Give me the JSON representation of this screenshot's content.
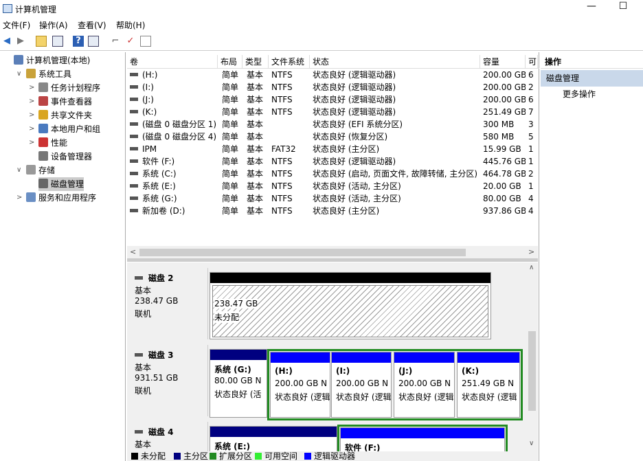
{
  "window": {
    "title": "计算机管理",
    "min": "—",
    "max": "☐"
  },
  "menu": [
    "文件(F)",
    "操作(A)",
    "查看(V)",
    "帮助(H)"
  ],
  "tree": [
    {
      "label": "计算机管理(本地)",
      "indent": 0,
      "exp": "",
      "icon": "#5b7fb8"
    },
    {
      "label": "系统工具",
      "indent": 1,
      "exp": "∨",
      "icon": "#c9a23a"
    },
    {
      "label": "任务计划程序",
      "indent": 2,
      "exp": ">",
      "icon": "#888"
    },
    {
      "label": "事件查看器",
      "indent": 2,
      "exp": ">",
      "icon": "#b44"
    },
    {
      "label": "共享文件夹",
      "indent": 2,
      "exp": ">",
      "icon": "#d9a520"
    },
    {
      "label": "本地用户和组",
      "indent": 2,
      "exp": ">",
      "icon": "#4a7abf"
    },
    {
      "label": "性能",
      "indent": 2,
      "exp": ">",
      "icon": "#c33"
    },
    {
      "label": "设备管理器",
      "indent": 2,
      "exp": "",
      "icon": "#777"
    },
    {
      "label": "存储",
      "indent": 1,
      "exp": "∨",
      "icon": "#999"
    },
    {
      "label": "磁盘管理",
      "indent": 2,
      "exp": "",
      "icon": "#666",
      "selected": true
    },
    {
      "label": "服务和应用程序",
      "indent": 1,
      "exp": ">",
      "icon": "#6a8fc4"
    }
  ],
  "columns": [
    "卷",
    "布局",
    "类型",
    "文件系统",
    "状态",
    "容量",
    "可"
  ],
  "volumes": [
    {
      "v": "(H:)",
      "l": "简单",
      "t": "基本",
      "f": "NTFS",
      "s": "状态良好 (逻辑驱动器)",
      "c": "200.00 GB",
      "x": "6"
    },
    {
      "v": "(I:)",
      "l": "简单",
      "t": "基本",
      "f": "NTFS",
      "s": "状态良好 (逻辑驱动器)",
      "c": "200.00 GB",
      "x": "2"
    },
    {
      "v": "(J:)",
      "l": "简单",
      "t": "基本",
      "f": "NTFS",
      "s": "状态良好 (逻辑驱动器)",
      "c": "200.00 GB",
      "x": "6"
    },
    {
      "v": "(K:)",
      "l": "简单",
      "t": "基本",
      "f": "NTFS",
      "s": "状态良好 (逻辑驱动器)",
      "c": "251.49 GB",
      "x": "7"
    },
    {
      "v": "(磁盘 0 磁盘分区 1)",
      "l": "简单",
      "t": "基本",
      "f": "",
      "s": "状态良好 (EFI 系统分区)",
      "c": "300 MB",
      "x": "3"
    },
    {
      "v": "(磁盘 0 磁盘分区 4)",
      "l": "简单",
      "t": "基本",
      "f": "",
      "s": "状态良好 (恢复分区)",
      "c": "580 MB",
      "x": "5"
    },
    {
      "v": "IPM",
      "l": "简单",
      "t": "基本",
      "f": "FAT32",
      "s": "状态良好 (主分区)",
      "c": "15.99 GB",
      "x": "1"
    },
    {
      "v": "软件 (F:)",
      "l": "简单",
      "t": "基本",
      "f": "NTFS",
      "s": "状态良好 (逻辑驱动器)",
      "c": "445.76 GB",
      "x": "1"
    },
    {
      "v": "系统 (C:)",
      "l": "简单",
      "t": "基本",
      "f": "NTFS",
      "s": "状态良好 (启动, 页面文件, 故障转储, 主分区)",
      "c": "464.78 GB",
      "x": "2"
    },
    {
      "v": "系统 (E:)",
      "l": "简单",
      "t": "基本",
      "f": "NTFS",
      "s": "状态良好 (活动, 主分区)",
      "c": "20.00 GB",
      "x": "1"
    },
    {
      "v": "系统 (G:)",
      "l": "简单",
      "t": "基本",
      "f": "NTFS",
      "s": "状态良好 (活动, 主分区)",
      "c": "80.00 GB",
      "x": "4"
    },
    {
      "v": "新加卷 (D:)",
      "l": "简单",
      "t": "基本",
      "f": "NTFS",
      "s": "状态良好 (主分区)",
      "c": "937.86 GB",
      "x": "4"
    }
  ],
  "disks": {
    "d2": {
      "name": "磁盘 2",
      "type": "基本",
      "size": "238.47 GB",
      "state": "联机",
      "p": {
        "size": "238.47 GB",
        "status": "未分配"
      }
    },
    "d3": {
      "name": "磁盘 3",
      "type": "基本",
      "size": "931.51 GB",
      "state": "联机",
      "g": {
        "name": "系统 (G:)",
        "size": "80.00 GB N",
        "status": "状态良好 (活"
      },
      "h": {
        "name": "(H:)",
        "size": "200.00 GB N",
        "status": "状态良好 (逻辑"
      },
      "i": {
        "name": "(I:)",
        "size": "200.00 GB N",
        "status": "状态良好 (逻辑"
      },
      "j": {
        "name": "(J:)",
        "size": "200.00 GB N",
        "status": "状态良好 (逻辑"
      },
      "k": {
        "name": "(K:)",
        "size": "251.49 GB N",
        "status": "状态良好 (逻辑"
      }
    },
    "d4": {
      "name": "磁盘 4",
      "type": "基本",
      "e": {
        "name": "系统 (E:)"
      },
      "f": {
        "name": "软件 (F:)"
      }
    }
  },
  "legend": [
    {
      "label": "未分配",
      "color": "#000000"
    },
    {
      "label": "主分区",
      "color": "#000080"
    },
    {
      "label": "扩展分区",
      "color": "#228b22"
    },
    {
      "label": "可用空间",
      "color": "#33ee33"
    },
    {
      "label": "逻辑驱动器",
      "color": "#0000ff"
    }
  ],
  "actions": {
    "header": "操作",
    "section": "磁盘管理",
    "more": "更多操作"
  },
  "colors": {
    "primary": "#000080",
    "logical": "#0000ff",
    "extended": "#228b22",
    "unallocated": "#000000"
  }
}
